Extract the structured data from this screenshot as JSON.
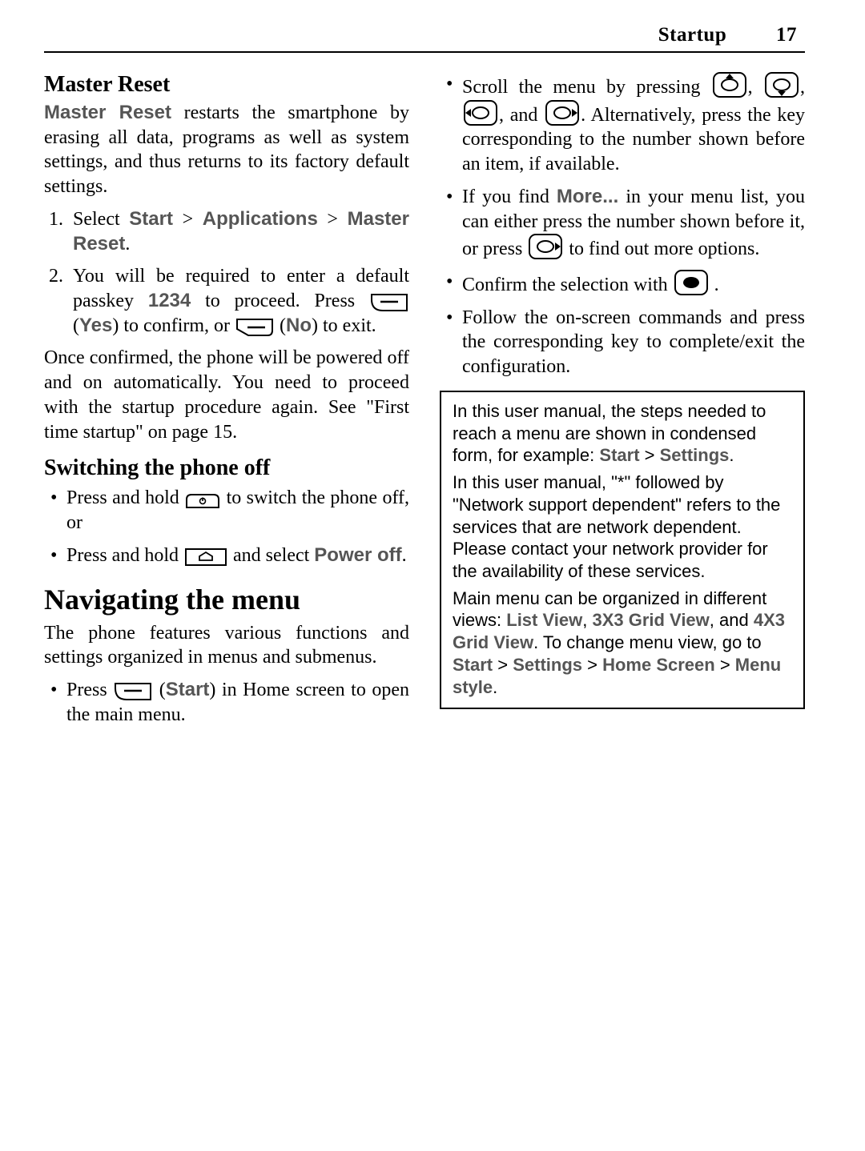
{
  "header": {
    "chapter": "Startup",
    "page": "17"
  },
  "master_reset": {
    "heading": "Master Reset",
    "intro_lead": "Master Reset",
    "intro_rest": " restarts the smartphone by erasing all data, programs as well as system settings, and thus returns to its factory default settings.",
    "steps": {
      "s1_a": "Select ",
      "s1_start": "Start",
      "s1_gt1": " > ",
      "s1_apps": "Applications",
      "s1_gt2": " > ",
      "s1_mr": "Master Reset",
      "s1_dot": ".",
      "s2_a": "You will be required to enter a default passkey ",
      "s2_passkey": "1234",
      "s2_b": " to proceed. Press ",
      "s2_yes_open": " (",
      "s2_yes": "Yes",
      "s2_yes_close": ") to confirm, or ",
      "s2_no_open": " (",
      "s2_no": "No",
      "s2_no_close": ") to exit."
    },
    "after": "Once confirmed, the phone will be powered off and on automatically. You need to proceed with the startup procedure again. See \"First time startup\" on page 15."
  },
  "switch_off": {
    "heading": "Switching the phone off",
    "b1_a": "Press and hold ",
    "b1_b": " to switch the phone off, or",
    "b2_a": "Press and hold ",
    "b2_b": " and select ",
    "b2_power": "Power off",
    "b2_dot": "."
  },
  "nav": {
    "heading": "Navigating the menu",
    "intro": "The phone features various functions and settings organized in menus and submenus.",
    "b1_a": "Press ",
    "b1_open": " (",
    "b1_start": "Start",
    "b1_close": ") in Home screen to open the main menu.",
    "b2_a": "Scroll the menu by pressing ",
    "b2_sep1": ", ",
    "b2_sep2": ", ",
    "b2_sep3": ", and ",
    "b2_tail": ". Alternatively, press the key ",
    "b2_cont": "corresponding to the number shown before an item, if available.",
    "b3_a": "If you find ",
    "b3_more": "More...",
    "b3_b": " in your menu list, you can either press the number shown before it, or press ",
    "b3_c": " to find out more options.",
    "b4_a": "Confirm the selection with ",
    "b4_dot": ".",
    "b5": "Follow the on-screen commands and press the corresponding key to complete/exit the configuration."
  },
  "note": {
    "p1_a": "In this user manual, the steps needed to reach a menu are shown in condensed form, for example: ",
    "p1_start": "Start",
    "p1_gt": " > ",
    "p1_settings": "Settings",
    "p1_dot": ".",
    "p2": "In this user manual, \"*\" followed by \"Network support dependent\" refers to the services that are network dependent. Please contact your network provider for the availability of these services.",
    "p3_a": "Main menu can be organized in different views: ",
    "p3_v1": "List View",
    "p3_c1": ", ",
    "p3_v2": "3X3 Grid View",
    "p3_c2": ", and ",
    "p3_v3": "4X3 Grid View",
    "p3_b": ". To change menu view, go to ",
    "p3_start": "Start",
    "p3_gt1": " > ",
    "p3_settings": "Settings",
    "p3_gt2": " > ",
    "p3_home": "Home Screen",
    "p3_gt3": " > ",
    "p3_ms": "Menu style",
    "p3_dot": "."
  }
}
